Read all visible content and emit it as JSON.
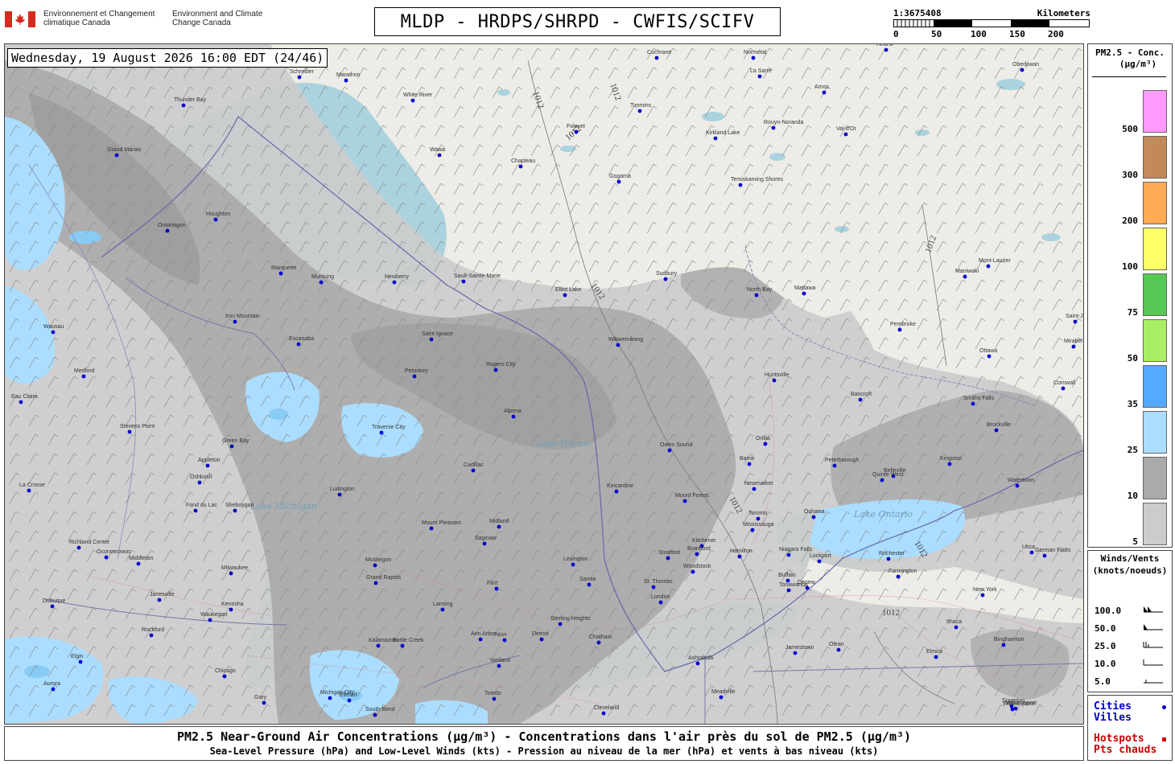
{
  "header": {
    "gov_fr": "Environnement et Changement climatique Canada",
    "gov_en": "Environment and Climate Change Canada",
    "title": "MLDP - HRDPS/SHRPD - CWFIS/SCIFV",
    "scale_ratio": "1:3675408",
    "scale_unit": "Kilometers",
    "scale_ticks": [
      "0",
      "50",
      "100",
      "150",
      "200"
    ]
  },
  "map": {
    "timestamp": "Wednesday, 19 August 2026 16:00 EDT (24/46)",
    "isobar_label": "1012",
    "cities": [
      {
        "name": "Cochrane"
      },
      {
        "name": "Normétal"
      },
      {
        "name": "Obedjiwan"
      },
      {
        "name": "La Sarre"
      },
      {
        "name": "Amos"
      },
      {
        "name": "Schreiber"
      },
      {
        "name": "Marathon"
      },
      {
        "name": "Thunder Bay"
      },
      {
        "name": "White River"
      },
      {
        "name": "Timmins"
      },
      {
        "name": "Kirkland Lake"
      },
      {
        "name": "Rouyn-Noranda"
      },
      {
        "name": "Val-d'Or"
      },
      {
        "name": "Hearst"
      },
      {
        "name": "Foleyet"
      },
      {
        "name": "Grand Marais"
      },
      {
        "name": "Wawa"
      },
      {
        "name": "Chapleau"
      },
      {
        "name": "Gogama"
      },
      {
        "name": "Temiskaming Shores"
      },
      {
        "name": "Houghton"
      },
      {
        "name": "Ontonagon"
      },
      {
        "name": "Marquette"
      },
      {
        "name": "Munising"
      },
      {
        "name": "Newberry"
      },
      {
        "name": "Sault-Sainte-Marie"
      },
      {
        "name": "Elliot Lake"
      },
      {
        "name": "Sudbury"
      },
      {
        "name": "Mattawa"
      },
      {
        "name": "North Bay"
      },
      {
        "name": "Maniwaki"
      },
      {
        "name": "Mont-Laurier"
      },
      {
        "name": "Saint-Jérôme"
      },
      {
        "name": "Mirabel"
      },
      {
        "name": "Pembroke"
      },
      {
        "name": "Ottawa"
      },
      {
        "name": "Cornwall"
      },
      {
        "name": "Iron Mountain"
      },
      {
        "name": "Escanaba"
      },
      {
        "name": "Saint Ignace"
      },
      {
        "name": "Rogers City"
      },
      {
        "name": "Petoskey"
      },
      {
        "name": "Wikwemikong"
      },
      {
        "name": "Huntsville"
      },
      {
        "name": "Bancroft"
      },
      {
        "name": "Smiths Falls"
      },
      {
        "name": "Brockville"
      },
      {
        "name": "Medford"
      },
      {
        "name": "Eau Claire"
      },
      {
        "name": "Stevens Point"
      },
      {
        "name": "Wausau"
      },
      {
        "name": "Green Bay"
      },
      {
        "name": "Traverse City"
      },
      {
        "name": "Alpena"
      },
      {
        "name": "Owen Sound"
      },
      {
        "name": "Orillia"
      },
      {
        "name": "Barrie"
      },
      {
        "name": "Peterborough"
      },
      {
        "name": "Belleville"
      },
      {
        "name": "Kingston"
      },
      {
        "name": "Watertown"
      },
      {
        "name": "Appleton"
      },
      {
        "name": "Oshkosh"
      },
      {
        "name": "Fond du Lac"
      },
      {
        "name": "Sheboygan"
      },
      {
        "name": "Ludington"
      },
      {
        "name": "Cadillac"
      },
      {
        "name": "Kincardine"
      },
      {
        "name": "Newmarket"
      },
      {
        "name": "Toronto"
      },
      {
        "name": "Mississauga"
      },
      {
        "name": "Oshawa"
      },
      {
        "name": "Quinte West"
      },
      {
        "name": "La Crosse"
      },
      {
        "name": "Richland Center"
      },
      {
        "name": "Oconomowoc"
      },
      {
        "name": "Milwaukee"
      },
      {
        "name": "Muskegon"
      },
      {
        "name": "Mount Pleasant"
      },
      {
        "name": "Midland"
      },
      {
        "name": "Saginaw"
      },
      {
        "name": "Mount Forest"
      },
      {
        "name": "Kitchener"
      },
      {
        "name": "Hamilton"
      },
      {
        "name": "Niagara Falls"
      },
      {
        "name": "Rochester"
      },
      {
        "name": "Utica"
      },
      {
        "name": "Middleton"
      },
      {
        "name": "Janesville"
      },
      {
        "name": "Grand Rapids"
      },
      {
        "name": "Lansing"
      },
      {
        "name": "Flint"
      },
      {
        "name": "Lexington"
      },
      {
        "name": "Sarnia"
      },
      {
        "name": "Stratford"
      },
      {
        "name": "Woodstock"
      },
      {
        "name": "Brantford"
      },
      {
        "name": "London"
      },
      {
        "name": "St. Thomas"
      },
      {
        "name": "Buffalo"
      },
      {
        "name": "Lockport"
      },
      {
        "name": "Depew"
      },
      {
        "name": "Tonawanda"
      },
      {
        "name": "Farmington"
      },
      {
        "name": "German Flatts"
      },
      {
        "name": "New York"
      },
      {
        "name": "Dubuque"
      },
      {
        "name": "Kenosha"
      },
      {
        "name": "Waukegan"
      },
      {
        "name": "Rockford"
      },
      {
        "name": "Kalamazoo"
      },
      {
        "name": "Battle Creek"
      },
      {
        "name": "Ann Arbor"
      },
      {
        "name": "Ypsilanti"
      },
      {
        "name": "Detroit"
      },
      {
        "name": "Sterling Heights"
      },
      {
        "name": "Novi"
      },
      {
        "name": "Chatham"
      },
      {
        "name": "Jamestown"
      },
      {
        "name": "Olean"
      },
      {
        "name": "Ithaca"
      },
      {
        "name": "Elmira"
      },
      {
        "name": "Binghamton"
      },
      {
        "name": "Elgin"
      },
      {
        "name": "Chicago"
      },
      {
        "name": "Aurora"
      },
      {
        "name": "Gary"
      },
      {
        "name": "Michigan City"
      },
      {
        "name": "South Bend"
      },
      {
        "name": "Elkhart"
      },
      {
        "name": "Toledo"
      },
      {
        "name": "Cleveland"
      },
      {
        "name": "Ashtabula"
      },
      {
        "name": "Meadville"
      },
      {
        "name": "Williamsport"
      },
      {
        "name": "Scranton"
      },
      {
        "name": "Wilkes-Barre"
      }
    ],
    "water_labels": [
      "Lake Michigan",
      "Lake Huron",
      "Lake Ontario"
    ]
  },
  "legend_pm": {
    "title_line1": "PM2.5 - Conc.",
    "title_line2": "(µg/m³)",
    "bins": [
      {
        "label": "500",
        "color": "#ff99ff"
      },
      {
        "label": "300",
        "color": "#c28a5a"
      },
      {
        "label": "200",
        "color": "#ffaa55"
      },
      {
        "label": "100",
        "color": "#ffff66"
      },
      {
        "label": "75",
        "color": "#55c855"
      },
      {
        "label": "50",
        "color": "#aaee66"
      },
      {
        "label": "35",
        "color": "#55aaff"
      },
      {
        "label": "25",
        "color": "#aaddff"
      },
      {
        "label": "10",
        "color": "#aaaaaa"
      },
      {
        "label": "5",
        "color": "#cccccc"
      }
    ]
  },
  "legend_wind": {
    "title_line1": "Winds/Vents",
    "title_line2": "(knots/noeuds)",
    "rows": [
      {
        "label": "100.0",
        "icon": "wind-barb-100-icon"
      },
      {
        "label": "50.0",
        "icon": "wind-barb-50-icon"
      },
      {
        "label": "25.0",
        "icon": "wind-barb-25-icon"
      },
      {
        "label": "10.0",
        "icon": "wind-barb-10-icon"
      },
      {
        "label": "5.0",
        "icon": "wind-barb-5-icon"
      }
    ]
  },
  "legend_cities": {
    "cities_en": "Cities",
    "cities_fr": "Villes",
    "hotspots_en": "Hotspots",
    "hotspots_fr": "Pts chauds",
    "cities_color": "#0000cc",
    "hotspots_color": "#cc0000"
  },
  "footer": {
    "line1": "PM2.5 Near-Ground Air Concentrations (µg/m³) - Concentrations dans l'air près du sol de PM2.5 (µg/m³)",
    "line2": "Sea-Level Pressure (hPa) and Low-Level Winds (kts) - Pression au niveau de la mer (hPa) et vents à bas niveau (kts)"
  }
}
